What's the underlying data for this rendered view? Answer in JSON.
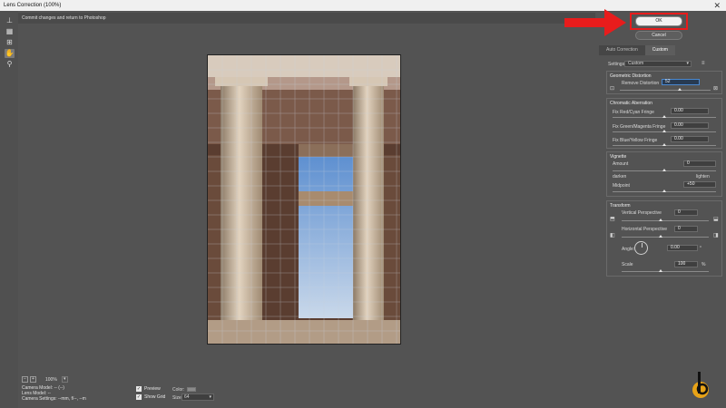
{
  "window": {
    "title": "Lens Correction (100%)",
    "close_glyph": "✕"
  },
  "hint": "Commit changes and return to Photoshop",
  "tools": [
    "straighten-icon",
    "remove-distortion-icon",
    "move-grid-icon",
    "hand-icon",
    "zoom-icon"
  ],
  "buttons": {
    "ok": "OK",
    "cancel": "Cancel"
  },
  "tabs": [
    {
      "label": "Auto Correction"
    },
    {
      "label": "Custom",
      "active": true
    }
  ],
  "settings": {
    "label": "Settings:",
    "value": "Custom",
    "menu_glyph": "≡"
  },
  "geometric": {
    "title": "Geometric Distortion",
    "label": "Remove Distortion",
    "value": "52"
  },
  "chromatic": {
    "title": "Chromatic Aberration",
    "rows": [
      {
        "label": "Fix Red/Cyan Fringe",
        "value": "0.00"
      },
      {
        "label": "Fix Green/Magenta Fringe",
        "value": "0.00"
      },
      {
        "label": "Fix Blue/Yellow Fringe",
        "value": "0.00"
      }
    ]
  },
  "vignette": {
    "title": "Vignette",
    "amount_label": "Amount",
    "amount_value": "0",
    "darken": "darken",
    "lighten": "lighten",
    "midpoint_label": "Midpoint",
    "midpoint_value": "+50"
  },
  "transform": {
    "title": "Transform",
    "vertical_label": "Vertical Perspective",
    "vertical_value": "0",
    "horizontal_label": "Horizontal Perspective",
    "horizontal_value": "0",
    "angle_label": "Angle:",
    "angle_value": "0.00",
    "angle_unit": "°",
    "scale_label": "Scale",
    "scale_value": "100",
    "scale_unit": "%"
  },
  "status": {
    "zoom": "100%",
    "camera_model": "Camera Model: -- (--)",
    "lens_model": "Lens Model: --",
    "camera_settings": "Camera Settings: --mm, f/--, --m",
    "preview_label": "Preview",
    "show_grid_label": "Show Grid",
    "color_label": "Color:",
    "size_label": "Size:",
    "size_value": "64"
  },
  "colors": {
    "accent_red": "#e81c1c",
    "panel": "#535353",
    "highlight_field": "#273a52"
  }
}
